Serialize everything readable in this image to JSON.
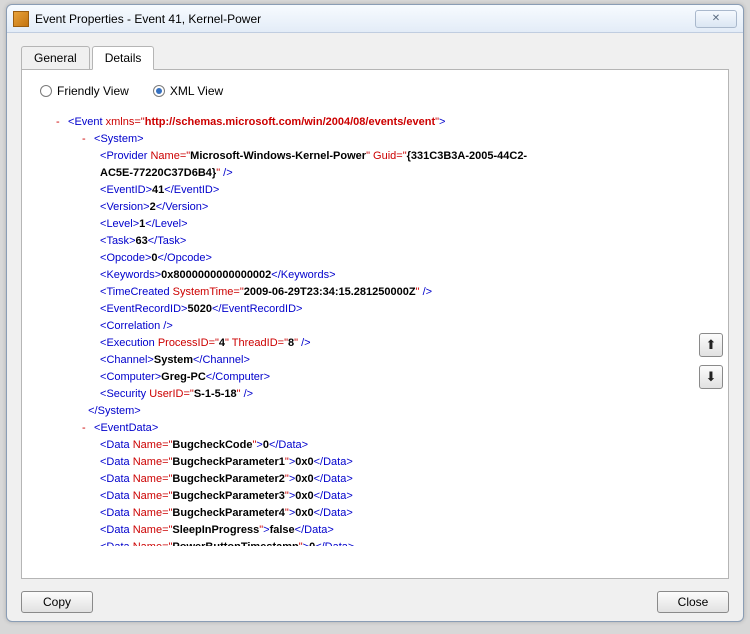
{
  "window": {
    "title": "Event Properties - Event 41, Kernel-Power"
  },
  "tabs": {
    "general": "General",
    "details": "Details",
    "active": "details"
  },
  "viewmode": {
    "friendly": "Friendly View",
    "xml": "XML View",
    "selected": "xml"
  },
  "buttons": {
    "copy": "Copy",
    "close": "Close"
  },
  "xml": {
    "root": {
      "name": "Event",
      "xmlnsAttr": "xmlns",
      "xmlns": "http://schemas.microsoft.com/win/2004/08/events/event"
    },
    "system": {
      "tag": "System",
      "provider": {
        "tag": "Provider",
        "nameAttr": "Name",
        "name": "Microsoft-Windows-Kernel-Power",
        "guidAttr": "Guid",
        "guid": "{331C3B3A-2005-44C2-AC5E-77220C37D6B4}"
      },
      "eventId": {
        "tag": "EventID",
        "val": "41"
      },
      "version": {
        "tag": "Version",
        "val": "2"
      },
      "level": {
        "tag": "Level",
        "val": "1"
      },
      "task": {
        "tag": "Task",
        "val": "63"
      },
      "opcode": {
        "tag": "Opcode",
        "val": "0"
      },
      "keywords": {
        "tag": "Keywords",
        "val": "0x8000000000000002"
      },
      "timeCreated": {
        "tag": "TimeCreated",
        "attr": "SystemTime",
        "val": "2009-06-29T23:34:15.281250000Z"
      },
      "eventRecordId": {
        "tag": "EventRecordID",
        "val": "5020"
      },
      "correlation": {
        "tag": "Correlation"
      },
      "execution": {
        "tag": "Execution",
        "pidAttr": "ProcessID",
        "pid": "4",
        "tidAttr": "ThreadID",
        "tid": "8"
      },
      "channel": {
        "tag": "Channel",
        "val": "System"
      },
      "computer": {
        "tag": "Computer",
        "val": "Greg-PC"
      },
      "security": {
        "tag": "Security",
        "attr": "UserID",
        "val": "S-1-5-18"
      }
    },
    "eventData": {
      "tag": "EventData",
      "dataTag": "Data",
      "nameAttr": "Name",
      "items": [
        {
          "name": "BugcheckCode",
          "val": "0"
        },
        {
          "name": "BugcheckParameter1",
          "val": "0x0"
        },
        {
          "name": "BugcheckParameter2",
          "val": "0x0"
        },
        {
          "name": "BugcheckParameter3",
          "val": "0x0"
        },
        {
          "name": "BugcheckParameter4",
          "val": "0x0"
        },
        {
          "name": "SleepInProgress",
          "val": "false"
        },
        {
          "name": "PowerButtonTimestamp",
          "val": "0"
        }
      ]
    }
  }
}
